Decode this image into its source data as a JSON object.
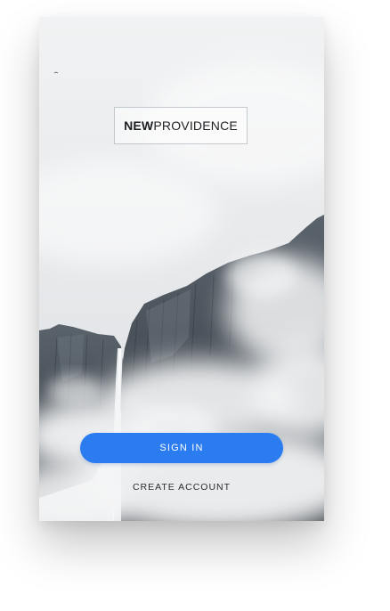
{
  "app": {
    "logo_bold": "NEW",
    "logo_light": "PROVIDENCE"
  },
  "actions": {
    "sign_in_label": "SIGN IN",
    "create_account_label": "CREATE ACCOUNT"
  },
  "colors": {
    "primary": "#2b7cf0",
    "background": "#ffffff",
    "text_dark": "#2a2c30"
  },
  "icons": {
    "background_image": "mountain-waterfall-mist-photo"
  }
}
